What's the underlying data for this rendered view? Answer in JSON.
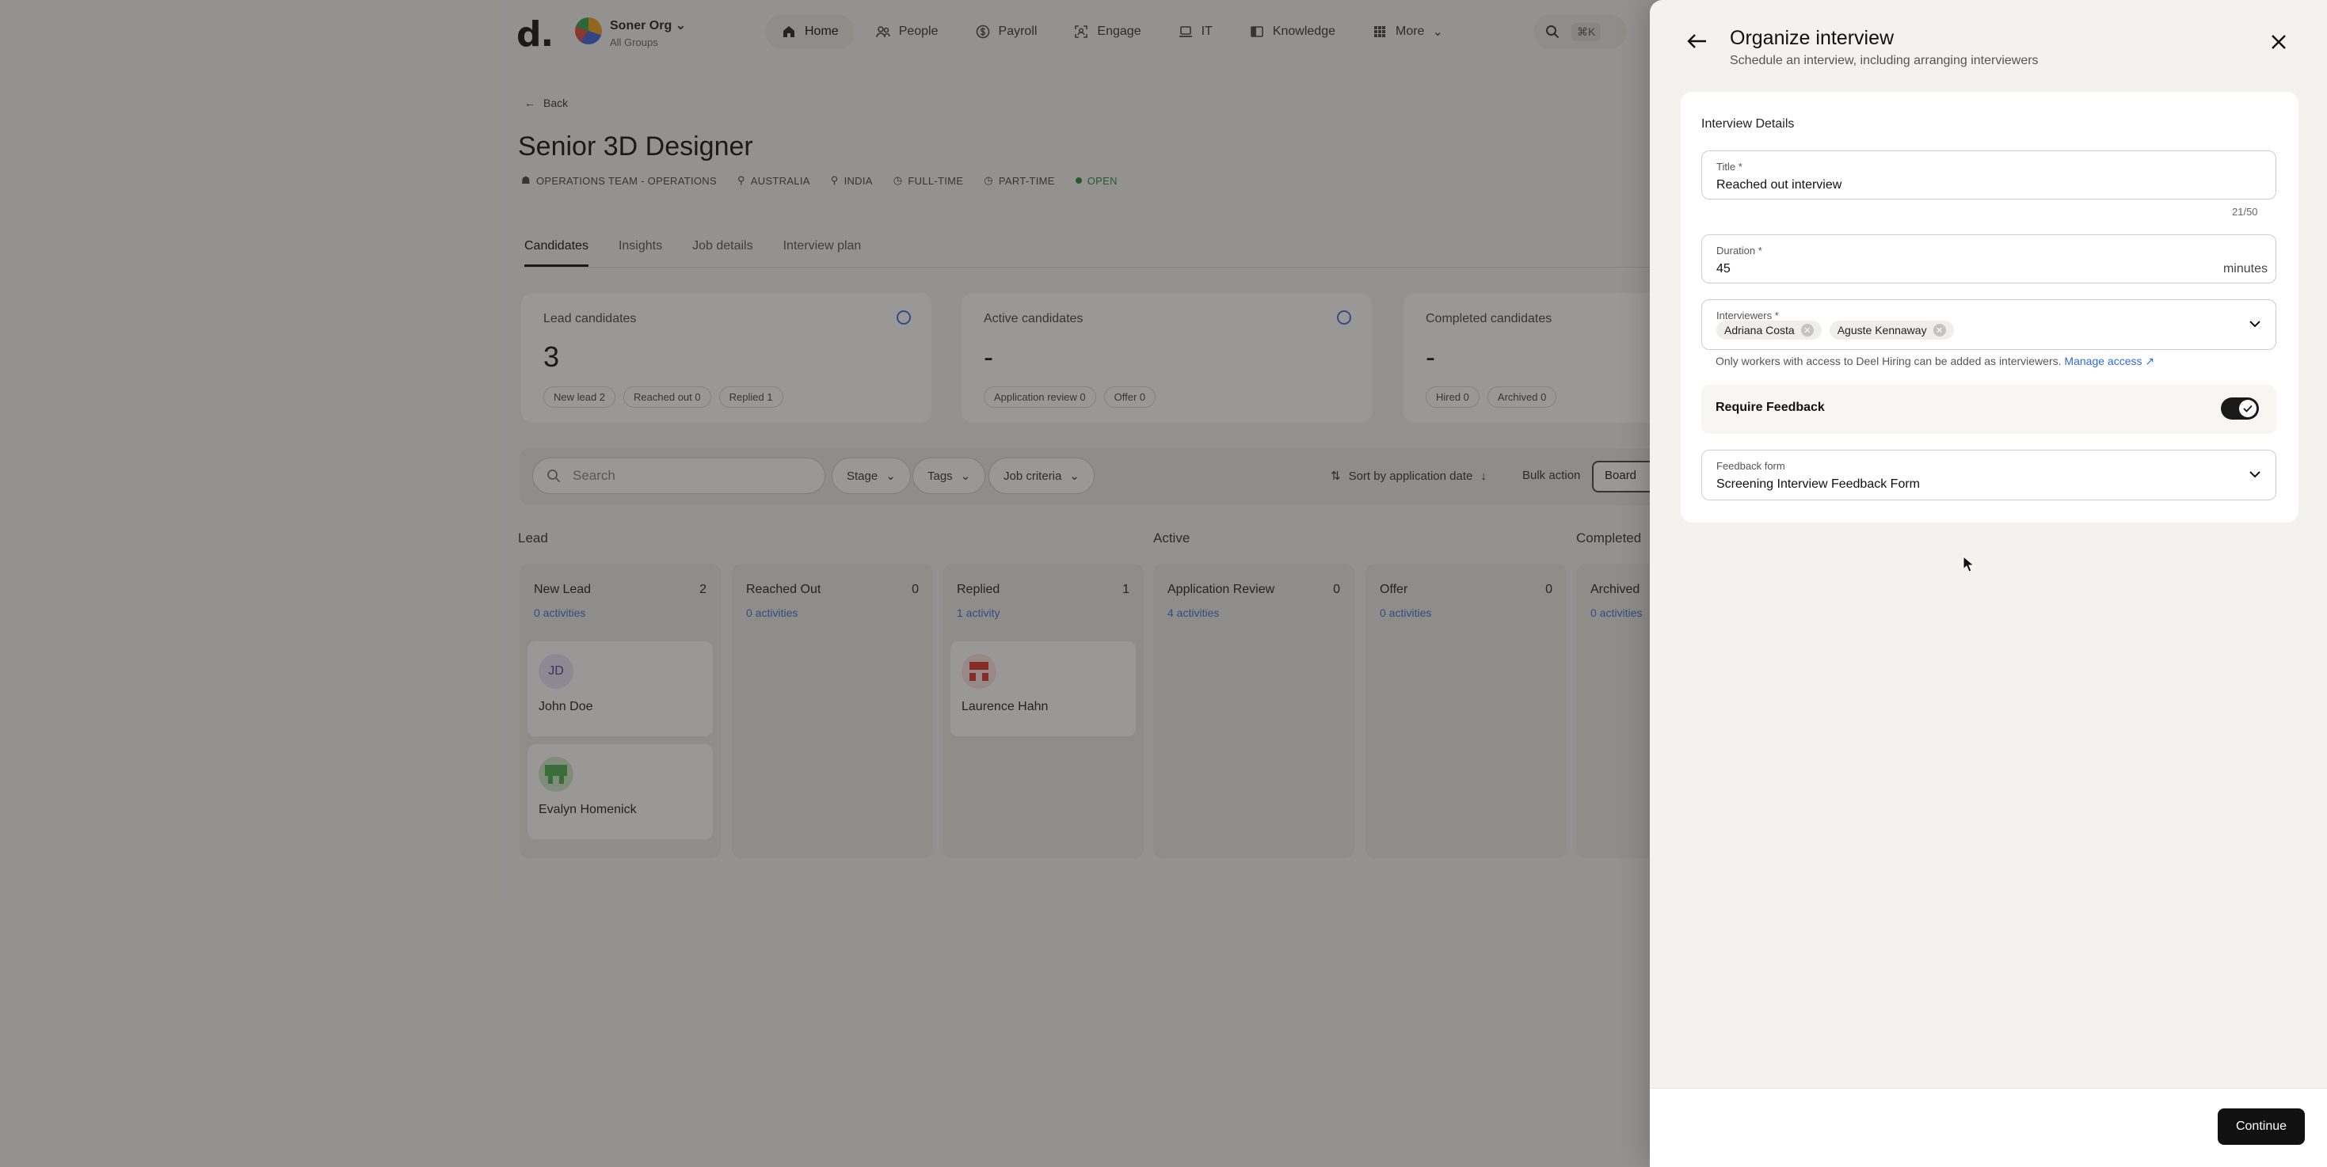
{
  "app": {
    "logo": "d.",
    "org_name": "Soner Org",
    "org_sub": "All Groups"
  },
  "nav": [
    {
      "label": "Home",
      "icon": "home-icon"
    },
    {
      "label": "People",
      "icon": "people-icon"
    },
    {
      "label": "Payroll",
      "icon": "payroll-icon"
    },
    {
      "label": "Engage",
      "icon": "engage-icon"
    },
    {
      "label": "IT",
      "icon": "laptop-icon"
    },
    {
      "label": "Knowledge",
      "icon": "book-icon"
    },
    {
      "label": "More",
      "icon": "grid-icon"
    }
  ],
  "search_shortcut": "⌘K",
  "page": {
    "back": "Back",
    "title": "Senior 3D Designer",
    "tags": [
      "OPERATIONS TEAM - OPERATIONS",
      "AUSTRALIA",
      "INDIA",
      "FULL-TIME",
      "PART-TIME",
      "OPEN"
    ],
    "tabs": [
      "Candidates",
      "Insights",
      "Job details",
      "Interview plan"
    ]
  },
  "stats": [
    {
      "title": "Lead candidates",
      "value": "3",
      "pills": [
        "New lead 2",
        "Reached out 0",
        "Replied 1"
      ]
    },
    {
      "title": "Active candidates",
      "value": "-",
      "pills": [
        "Application review 0",
        "Offer 0"
      ]
    },
    {
      "title": "Completed candidates",
      "value": "-",
      "pills": [
        "Hired 0",
        "Archived 0"
      ]
    }
  ],
  "toolbar": {
    "search_placeholder": "Search",
    "filters": [
      "Stage",
      "Tags",
      "Job criteria"
    ],
    "sort": "Sort by application date",
    "bulk": "Bulk action",
    "view": "Board"
  },
  "groups": [
    "Lead",
    "Active",
    "Completed"
  ],
  "columns": [
    {
      "title": "New Lead",
      "count": "2",
      "activities": "0 activities",
      "cards": [
        {
          "name": "John Doe",
          "initials": "JD"
        },
        {
          "name": "Evalyn Homenick",
          "initials": ""
        }
      ]
    },
    {
      "title": "Reached Out",
      "count": "0",
      "activities": "0 activities",
      "cards": []
    },
    {
      "title": "Replied",
      "count": "1",
      "activities": "1 activity",
      "cards": [
        {
          "name": "Laurence Hahn",
          "initials": ""
        }
      ]
    },
    {
      "title": "Application Review",
      "count": "0",
      "activities": "4 activities",
      "cards": []
    },
    {
      "title": "Offer",
      "count": "0",
      "activities": "0 activities",
      "cards": []
    },
    {
      "title": "Archived",
      "count": "",
      "activities": "0 activities",
      "cards": []
    }
  ],
  "panel": {
    "title": "Organize interview",
    "subtitle": "Schedule an interview, including arranging interviewers",
    "section": "Interview Details",
    "title_label": "Title *",
    "title_value": "Reached out interview",
    "title_counter": "21/50",
    "duration_label": "Duration *",
    "duration_value": "45",
    "duration_unit": "minutes",
    "interviewers_label": "Interviewers *",
    "interviewers": [
      "Adriana Costa",
      "Aguste Kennaway"
    ],
    "hint": "Only workers with access to Deel Hiring can be added as interviewers.",
    "hint_link": "Manage access",
    "require_feedback": "Require Feedback",
    "require_feedback_on": true,
    "feedback_label": "Feedback form",
    "feedback_value": "Screening Interview Feedback Form",
    "continue": "Continue"
  }
}
